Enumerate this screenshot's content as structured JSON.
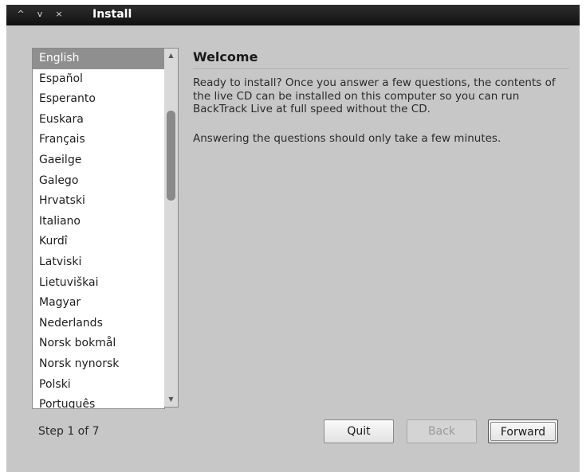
{
  "window": {
    "title": "Install",
    "controls": {
      "minimize": "^",
      "maximize": "v",
      "close": "×"
    }
  },
  "languages": {
    "items": [
      "English",
      "Español",
      "Esperanto",
      "Euskara",
      "Français",
      "Gaeilge",
      "Galego",
      "Hrvatski",
      "Italiano",
      "Kurdî",
      "Latviski",
      "Lietuviškai",
      "Magyar",
      "Nederlands",
      "Norsk bokmål",
      "Norsk nynorsk",
      "Polski",
      "Português"
    ],
    "selected": "English"
  },
  "content": {
    "heading": "Welcome",
    "paragraph1": "Ready to install?  Once you answer a few questions, the contents of the live CD can be installed on this computer so you can run BackTrack Live at full speed without the CD.",
    "paragraph2": "Answering the questions should only take a few minutes."
  },
  "footer": {
    "step": "Step 1 of 7",
    "quit_label": "Quit",
    "back_label": "Back",
    "forward_label": "Forward"
  }
}
